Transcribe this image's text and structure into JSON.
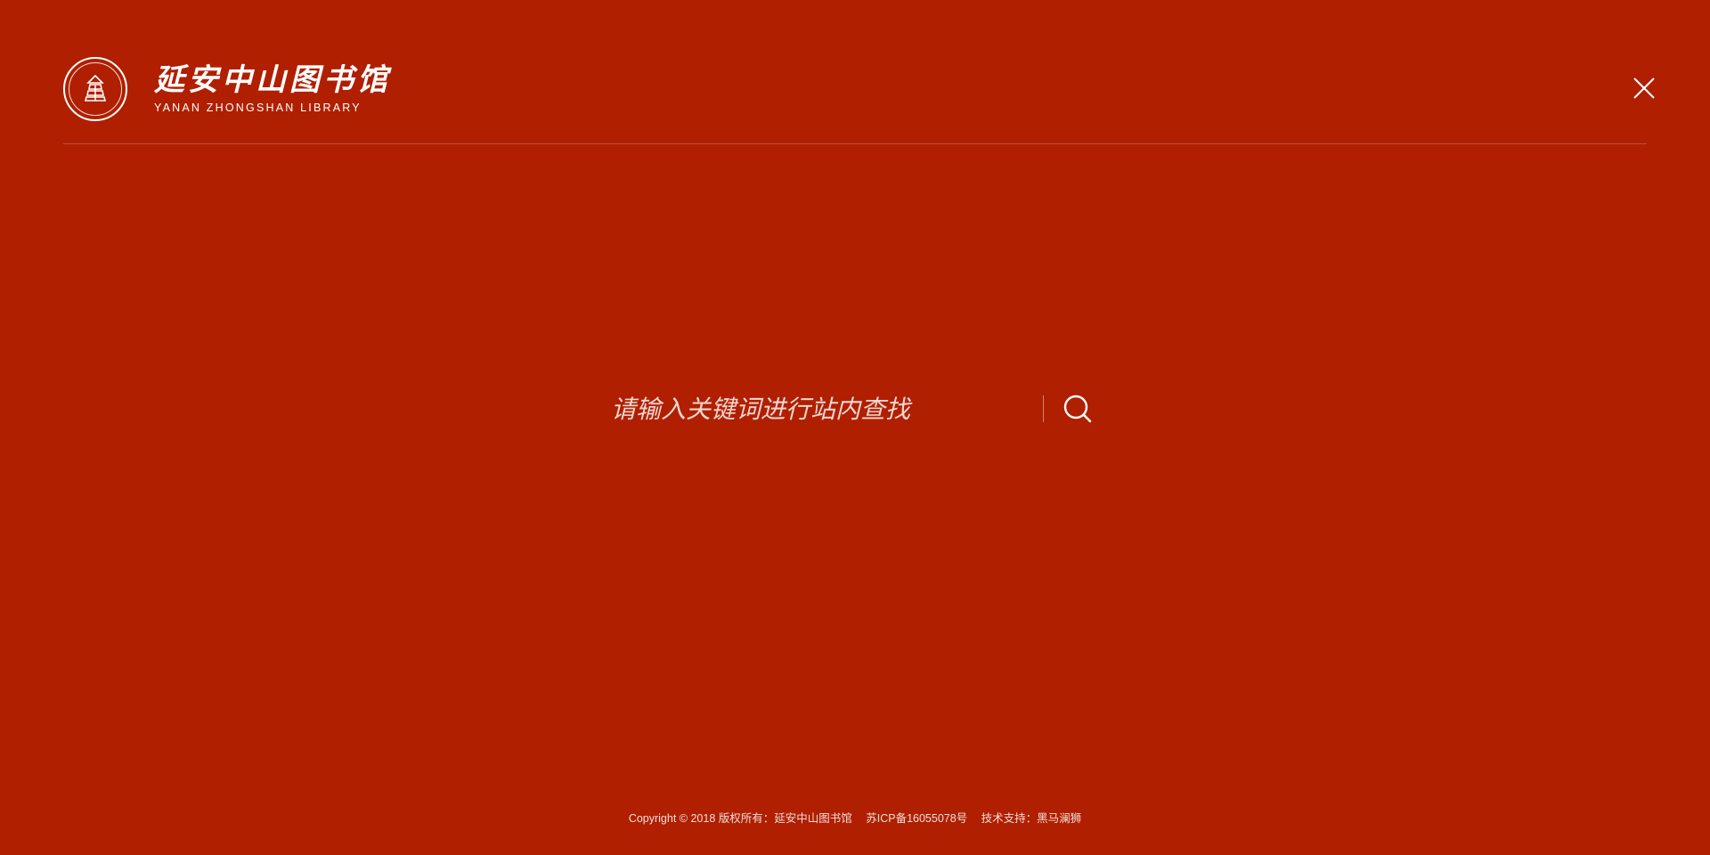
{
  "header": {
    "logo_cn": "延安中山图书馆",
    "logo_en": "YANAN ZHONGSHAN LIBRARY",
    "close_icon": "close-icon"
  },
  "search": {
    "placeholder": "请输入关键词进行站内查找",
    "value": "",
    "icon": "search-icon"
  },
  "footer": {
    "copyright": "Copyright © 2018 版权所有：延安中山图书馆",
    "icp": "苏ICP备16055078号",
    "support": "技术支持：黑马澜狮"
  },
  "colors": {
    "background": "#b01f00",
    "foreground": "#ffffff"
  }
}
